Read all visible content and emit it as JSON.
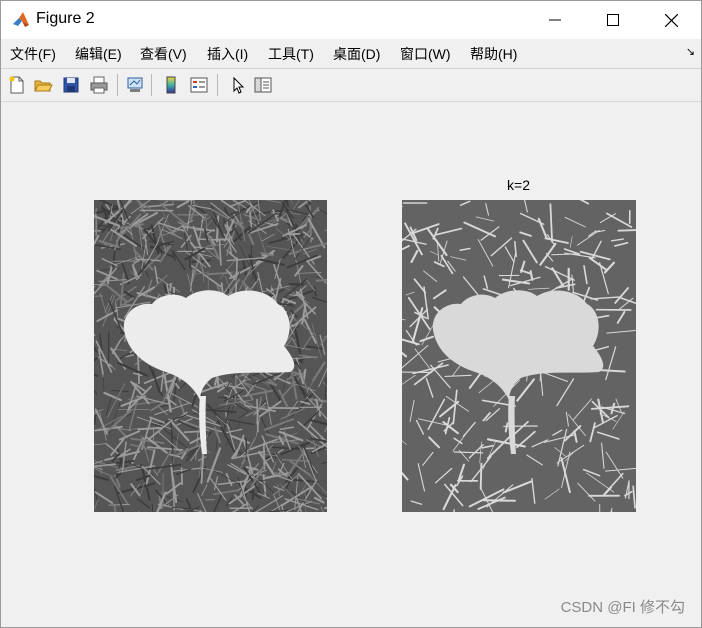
{
  "window": {
    "title": "Figure 2"
  },
  "menu": [
    {
      "label": "文件(F)"
    },
    {
      "label": "编辑(E)"
    },
    {
      "label": "查看(V)"
    },
    {
      "label": "插入(I)"
    },
    {
      "label": "工具(T)"
    },
    {
      "label": "桌面(D)"
    },
    {
      "label": "窗口(W)"
    },
    {
      "label": "帮助(H)"
    }
  ],
  "toolbar": {
    "icons": [
      "new-figure-icon",
      "open-file-icon",
      "save-icon",
      "print-icon",
      "link-plot-icon",
      "insert-colorbar-icon",
      "insert-legend-icon",
      "pointer-icon",
      "property-inspector-icon"
    ]
  },
  "figure": {
    "left_axes": {
      "title": ""
    },
    "right_axes": {
      "title": "k=2"
    }
  },
  "colors": {
    "grass_dark": "#555555",
    "grass_light": "#9c9c9c",
    "leaf": "#ececec",
    "segment_dark": "#636363",
    "segment_light": "#d9d9d9"
  },
  "watermark": "CSDN @FI 修不勾"
}
